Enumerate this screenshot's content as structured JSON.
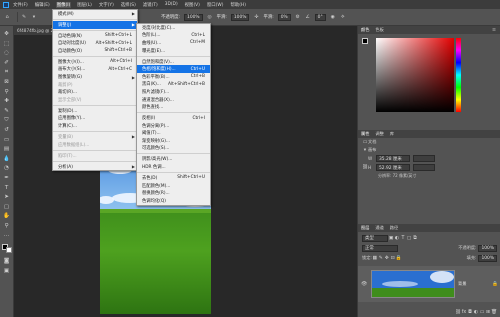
{
  "menubar": {
    "items": [
      "文件(F)",
      "编辑(E)",
      "图像(I)",
      "图层(L)",
      "文字(Y)",
      "选择(S)",
      "滤镜(T)",
      "3D(D)",
      "视图(V)",
      "窗口(W)",
      "帮助(H)"
    ],
    "active_index": 2
  },
  "options": {
    "mode_label": "不透明度:",
    "opacity_value": "100%",
    "flow_label": "平滑:",
    "flow_value": "0%",
    "angle_value": "0°",
    "ratio_value": "100%"
  },
  "document": {
    "tab_title": "6f4874fb.jpg @ 25%(RGB/8)"
  },
  "image_menu": {
    "items": [
      {
        "label": "模式(M)",
        "shortcut": "",
        "submenu": true,
        "state": "normal"
      },
      {
        "divider": true
      },
      {
        "label": "调整(J)",
        "shortcut": "",
        "submenu": true,
        "state": "highlight"
      },
      {
        "divider": true
      },
      {
        "label": "自动色调(N)",
        "shortcut": "Shift+Ctrl+L",
        "submenu": false,
        "state": "normal"
      },
      {
        "label": "自动对比度(U)",
        "shortcut": "Alt+Shift+Ctrl+L",
        "submenu": false,
        "state": "normal"
      },
      {
        "label": "自动颜色(O)",
        "shortcut": "Shift+Ctrl+B",
        "submenu": false,
        "state": "normal"
      },
      {
        "divider": true
      },
      {
        "label": "图像大小(I)...",
        "shortcut": "Alt+Ctrl+I",
        "submenu": false,
        "state": "normal"
      },
      {
        "label": "画布大小(S)...",
        "shortcut": "Alt+Ctrl+C",
        "submenu": false,
        "state": "normal"
      },
      {
        "label": "图像旋转(G)",
        "shortcut": "",
        "submenu": true,
        "state": "normal"
      },
      {
        "label": "裁剪(P)",
        "shortcut": "",
        "submenu": false,
        "state": "disabled"
      },
      {
        "label": "裁切(R)...",
        "shortcut": "",
        "submenu": false,
        "state": "normal"
      },
      {
        "label": "显示全部(V)",
        "shortcut": "",
        "submenu": false,
        "state": "disabled"
      },
      {
        "divider": true
      },
      {
        "label": "复制(D)...",
        "shortcut": "",
        "submenu": false,
        "state": "normal"
      },
      {
        "label": "应用图像(Y)...",
        "shortcut": "",
        "submenu": false,
        "state": "normal"
      },
      {
        "label": "计算(C)...",
        "shortcut": "",
        "submenu": false,
        "state": "normal"
      },
      {
        "divider": true
      },
      {
        "label": "变量(B)",
        "shortcut": "",
        "submenu": true,
        "state": "disabled"
      },
      {
        "label": "应用数据组(L)...",
        "shortcut": "",
        "submenu": false,
        "state": "disabled"
      },
      {
        "divider": true
      },
      {
        "label": "陷印(T)...",
        "shortcut": "",
        "submenu": false,
        "state": "disabled"
      },
      {
        "divider": true
      },
      {
        "label": "分析(A)",
        "shortcut": "",
        "submenu": true,
        "state": "normal"
      }
    ]
  },
  "adjust_menu": {
    "items": [
      {
        "label": "亮度/对比度(C)...",
        "shortcut": "",
        "state": "normal"
      },
      {
        "label": "色阶(L)...",
        "shortcut": "Ctrl+L",
        "state": "normal"
      },
      {
        "label": "曲线(U)...",
        "shortcut": "Ctrl+M",
        "state": "normal"
      },
      {
        "label": "曝光度(E)...",
        "shortcut": "",
        "state": "normal"
      },
      {
        "divider": true
      },
      {
        "label": "自然饱和度(V)...",
        "shortcut": "",
        "state": "normal"
      },
      {
        "label": "色相/饱和度(H)...",
        "shortcut": "Ctrl+U",
        "state": "highlight"
      },
      {
        "label": "色彩平衡(B)...",
        "shortcut": "Ctrl+B",
        "state": "normal"
      },
      {
        "label": "黑白(K)...",
        "shortcut": "Alt+Shift+Ctrl+B",
        "state": "normal"
      },
      {
        "label": "照片滤镜(F)...",
        "shortcut": "",
        "state": "normal"
      },
      {
        "label": "通道混合器(X)...",
        "shortcut": "",
        "state": "normal"
      },
      {
        "label": "颜色查找...",
        "shortcut": "",
        "state": "normal"
      },
      {
        "divider": true
      },
      {
        "label": "反相(I)",
        "shortcut": "Ctrl+I",
        "state": "normal"
      },
      {
        "label": "色调分离(P)...",
        "shortcut": "",
        "state": "normal"
      },
      {
        "label": "阈值(T)...",
        "shortcut": "",
        "state": "normal"
      },
      {
        "label": "渐变映射(G)...",
        "shortcut": "",
        "state": "normal"
      },
      {
        "label": "可选颜色(S)...",
        "shortcut": "",
        "state": "normal"
      },
      {
        "divider": true
      },
      {
        "label": "阴影/高光(W)...",
        "shortcut": "",
        "state": "normal"
      },
      {
        "label": "HDR 色调...",
        "shortcut": "",
        "state": "normal"
      },
      {
        "divider": true
      },
      {
        "label": "去色(D)",
        "shortcut": "Shift+Ctrl+U",
        "state": "normal"
      },
      {
        "label": "匹配颜色(M)...",
        "shortcut": "",
        "state": "normal"
      },
      {
        "label": "替换颜色(R)...",
        "shortcut": "",
        "state": "normal"
      },
      {
        "label": "色调均化(Q)",
        "shortcut": "",
        "state": "normal"
      }
    ]
  },
  "colors": {
    "accent": "#1473e6",
    "menu_bg": "#eeeeee",
    "panel": "#535353"
  },
  "panels": {
    "color_tabs": [
      "颜色",
      "色板"
    ],
    "props_tabs": [
      "属性",
      "调整",
      "库"
    ],
    "props_doc_label": "文档",
    "props_section": "画布",
    "width_label": "W",
    "width_value": "35.28 厘米",
    "height_label": "H",
    "height_value": "52.92 厘米",
    "resolution": "分辨率: 72 像素/英寸",
    "layers_tabs": [
      "图层",
      "通道",
      "路径"
    ],
    "layers_kind": "类型",
    "layers_blend": "正常",
    "layers_opacity_label": "不透明度:",
    "layers_opacity": "100%",
    "layers_lock": "锁定:",
    "layers_fill_label": "填充:",
    "layers_fill": "100%",
    "layer_name": "背景"
  }
}
